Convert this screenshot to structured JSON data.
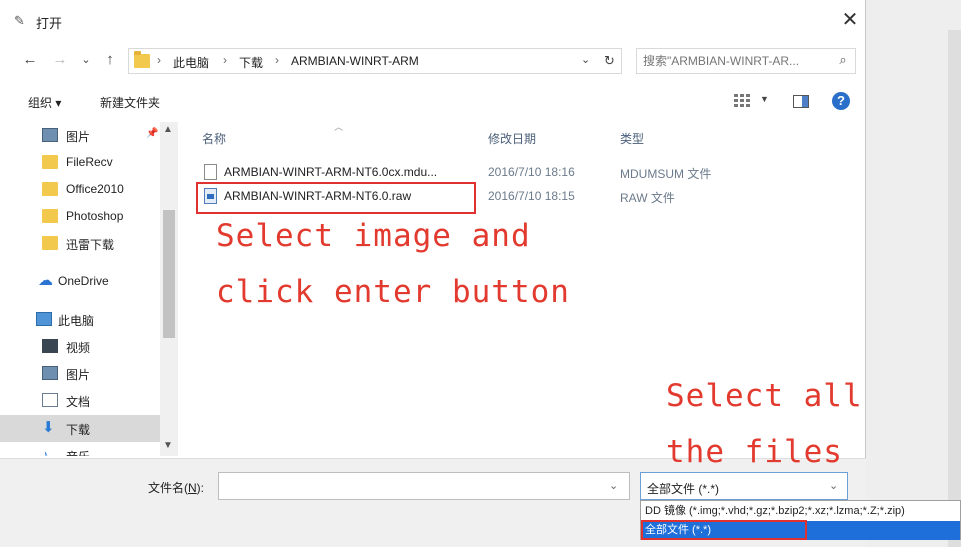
{
  "dialog": {
    "title": "打开",
    "close_glyph": "✕"
  },
  "nav_buttons": {
    "back": "←",
    "forward": "→",
    "recent": "⌄",
    "up": "↑"
  },
  "address": {
    "crumbs": [
      "此电脑",
      "下载",
      "ARMBIAN-WINRT-ARM"
    ],
    "separator": "›",
    "dropdown_glyph": "⌄",
    "refresh_glyph": "↻"
  },
  "search": {
    "placeholder": "搜索\"ARMBIAN-WINRT-AR...",
    "icon_glyph": "⌕"
  },
  "toolbar": {
    "organize_label": "组织 ▾",
    "new_folder_label": "新建文件夹",
    "view_dropdown_glyph": "▼",
    "help_glyph": "?"
  },
  "sidebar": {
    "items": [
      {
        "label": "图片",
        "icon": "pictures-icon"
      },
      {
        "label": "FileRecv",
        "icon": "folder-icon"
      },
      {
        "label": "Office2010",
        "icon": "folder-icon"
      },
      {
        "label": "Photoshop",
        "icon": "folder-icon"
      },
      {
        "label": "迅雷下载",
        "icon": "folder-icon"
      },
      {
        "label": "OneDrive",
        "icon": "onedrive-icon"
      },
      {
        "label": "此电脑",
        "icon": "pc-icon"
      },
      {
        "label": "视频",
        "icon": "video-icon"
      },
      {
        "label": "图片",
        "icon": "pictures-icon"
      },
      {
        "label": "文档",
        "icon": "documents-icon"
      },
      {
        "label": "下载",
        "icon": "downloads-icon"
      },
      {
        "label": "音乐",
        "icon": "music-icon"
      }
    ],
    "pin_glyph": "📌"
  },
  "columns": {
    "name": "名称",
    "modified": "修改日期",
    "type": "类型"
  },
  "files": [
    {
      "name": "ARMBIAN-WINRT-ARM-NT6.0cx.mdu...",
      "modified": "2016/7/10 18:16",
      "type": "MDUMSUM 文件"
    },
    {
      "name": "ARMBIAN-WINRT-ARM-NT6.0.raw",
      "modified": "2016/7/10 18:15",
      "type": "RAW 文件"
    }
  ],
  "annotations": {
    "select_image_line1": "Select image and",
    "select_image_line2": "click enter button",
    "select_all_line1": "Select all",
    "select_all_line2": "the files"
  },
  "bottom": {
    "filename_label_prefix": "文件名(",
    "filename_label_key": "N",
    "filename_label_suffix": "):",
    "filename_value": "",
    "dropdown_glyph": "⌄",
    "filter_value": "全部文件 (*.*)"
  },
  "filter_options": [
    "DD 镜像 (*.img;*.vhd;*.gz;*.bzip2;*.xz;*.lzma;*.Z;*.zip)",
    "全部文件 (*.*)"
  ],
  "colors": {
    "annotation": "#e23a2e",
    "selection": "#1e6fd9",
    "highlight_border": "#e03030"
  }
}
